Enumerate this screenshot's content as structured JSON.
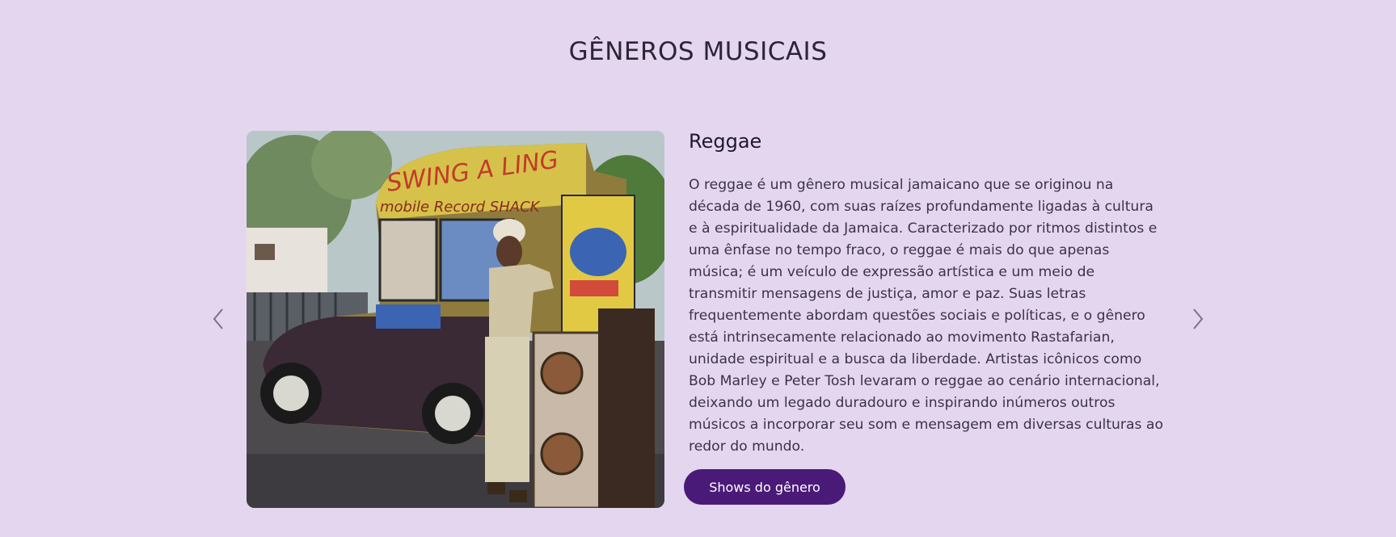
{
  "section": {
    "title": "GÊNEROS MUSICAIS"
  },
  "carousel": {
    "prev_icon": "chevron-left-icon",
    "next_icon": "chevron-right-icon",
    "slide": {
      "image_alt": "mobile record shack van",
      "image_text": {
        "van_sign_1": "SWING A LING",
        "van_sign_2": "mobile Record SHACK"
      },
      "genre_name": "Reggae",
      "description": "O reggae é um gênero musical jamaicano que se originou na década de 1960, com suas raízes profundamente ligadas à cultura e à espiritualidade da Jamaica. Caracterizado por ritmos distintos e uma ênfase no tempo fraco, o reggae é mais do que apenas música; é um veículo de expressão artística e um meio de transmitir mensagens de justiça, amor e paz. Suas letras frequentemente abordam questões sociais e políticas, e o gênero está intrinsecamente relacionado ao movimento Rastafarian, unidade espiritual e a busca da liberdade. Artistas icônicos como Bob Marley e Peter Tosh levaram o reggae ao cenário internacional, deixando um legado duradouro e inspirando inúmeros outros músicos a incorporar seu som e mensagem em diversas culturas ao redor do mundo.",
      "button_label": "Shows do gênero"
    }
  },
  "colors": {
    "background": "#e5d6f0",
    "button": "#4a1a78",
    "arrow": "#7a7388"
  }
}
